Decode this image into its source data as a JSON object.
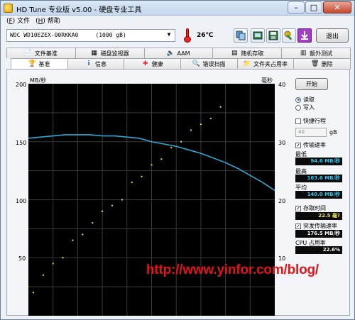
{
  "window": {
    "title": "HD Tune 专业版 v5.00 - 硬盘专业工具"
  },
  "menu": {
    "file": "文件",
    "help": "帮助"
  },
  "toolbar": {
    "drive": "WDC WD10EZEX-00RKKA0     (1000 gB)",
    "temperature": "26℃",
    "exit": "退出",
    "buttons": [
      "copy-icon",
      "copy-screen-icon",
      "save-icon",
      "wrench-icon",
      "download-icon"
    ]
  },
  "tabs": {
    "row1": [
      "文件基准",
      "磁盘监视器",
      "AAM",
      "随机存取",
      "额外测试"
    ],
    "row2": [
      "基准",
      "信息",
      "健康",
      "错误扫描",
      "文件夹占用率",
      "删除"
    ]
  },
  "chart": {
    "left_unit": "MB/秒",
    "right_unit": "毫秒",
    "y_left_ticks": [
      "200",
      "150",
      "100",
      "50"
    ],
    "y_right_ticks": [
      "40",
      "30",
      "20",
      "10"
    ]
  },
  "side": {
    "start": "开始",
    "read": "读取",
    "write": "写入",
    "quick": "快捷行程",
    "quick_value": "40",
    "quick_unit": "gB",
    "transfer": "传输速率",
    "min_label": "最低",
    "min_value": "94.6 MB/秒",
    "max_label": "最高",
    "max_value": "163.6 MB/秒",
    "avg_label": "平均",
    "avg_value": "140.0 MB/秒",
    "access": "存取时间",
    "access_value": "22.5 毫?",
    "burst": "突发传输速率",
    "burst_value": "176.5 MB/秒",
    "cpu": "CPU 占用率",
    "cpu_value": "22.6%"
  },
  "watermark": "http://www.yinfor.com/blog/",
  "chart_data": {
    "type": "line",
    "title": "",
    "xlabel": "",
    "ylabel": "MB/秒",
    "y2label": "毫秒",
    "x": [
      0,
      5,
      10,
      15,
      20,
      25,
      30,
      35,
      40,
      45,
      50,
      55,
      60,
      65,
      70,
      75,
      80,
      85,
      90,
      95,
      100
    ],
    "xlim": [
      0,
      100
    ],
    "ylim": [
      0,
      200
    ],
    "y2lim": [
      0,
      40
    ],
    "series": [
      {
        "values": [
          153,
          154,
          155,
          156,
          156,
          156,
          155,
          155,
          154,
          153,
          150,
          148,
          146,
          143,
          140,
          136,
          132,
          127,
          121,
          115,
          108
        ]
      }
    ],
    "scatter_access_ms": {
      "x": [
        2,
        6,
        10,
        14,
        18,
        22,
        26,
        30,
        34,
        38,
        42,
        46,
        50,
        54,
        58,
        62,
        66,
        70,
        74,
        78
      ],
      "y": [
        4,
        7,
        9,
        10,
        13,
        14,
        16,
        18,
        19,
        20,
        23,
        24,
        26,
        27,
        29,
        30,
        32,
        33,
        34,
        36
      ]
    },
    "stats": {
      "min": 94.6,
      "max": 163.6,
      "avg": 140.0
    },
    "grid": true
  }
}
